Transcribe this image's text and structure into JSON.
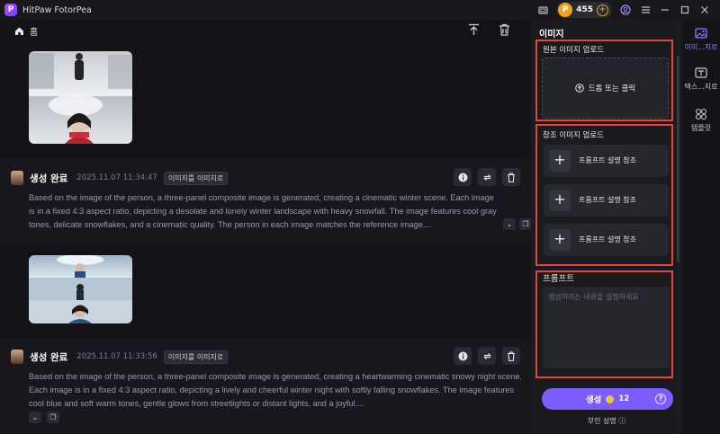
{
  "titlebar": {
    "app_title": "HitPaw FotorPea",
    "logo_letter": "P",
    "coin_count": "455",
    "coin_add": "+",
    "avatar_letter": "P"
  },
  "toolbar": {
    "home_label": "홈"
  },
  "results": [
    {
      "status": "생성 완료",
      "time": "2025.11.07   11:34:47",
      "tag": "이미지를 이미지로",
      "text": "Based on the image of the person, a three-panel composite image is generated, creating a cinematic winter scene. Each image is in a fixed 4:3 aspect ratio, depicting a desolate and lonely winter landscape with heavy snowfall. The image features cool gray tones, delicate snowflakes, and a cinematic quality. The person in each image matches the reference image...."
    },
    {
      "status": "생성 완료",
      "time": "2025.11.07   11:33:56",
      "tag": "이미지를 이미지로",
      "text": "Based on the image of the person, a three-panel composite image is generated, creating a heartwarming cinematic snowy night scene. Each image is in a fixed 4:3 aspect ratio, depicting a lively and cheerful winter night with softly falling snowflakes. The image features cool blue and soft warm tones, gentle glows from streetlights or distant lights, and a joyful...."
    }
  ],
  "panel": {
    "title": "이미지",
    "upload_label": "원본 이미지 업로드",
    "dropzone_text": "드롭 또는 클릭",
    "ref_label": "참조 이미지 업로드",
    "ref_items": [
      "프롬프트 설명 참조",
      "프롬프트 설명 참조",
      "프롬프트 설명 참조"
    ],
    "prompt_label": "프롬프트",
    "prompt_placeholder": "생성하려는 내용을 설명하세요",
    "generate_label": "생성",
    "generate_cost": "12",
    "negative_label": "부인 성명"
  },
  "rail": {
    "items": [
      {
        "label": "이미...지로",
        "icon": "image-icon",
        "active": true
      },
      {
        "label": "텍스...지로",
        "icon": "text-image-icon",
        "active": false
      },
      {
        "label": "템플릿",
        "icon": "template-icon",
        "active": false
      }
    ]
  },
  "colors": {
    "accent": "#7c5cff",
    "highlight": "#e0463a",
    "coin": "#f0a41a"
  }
}
